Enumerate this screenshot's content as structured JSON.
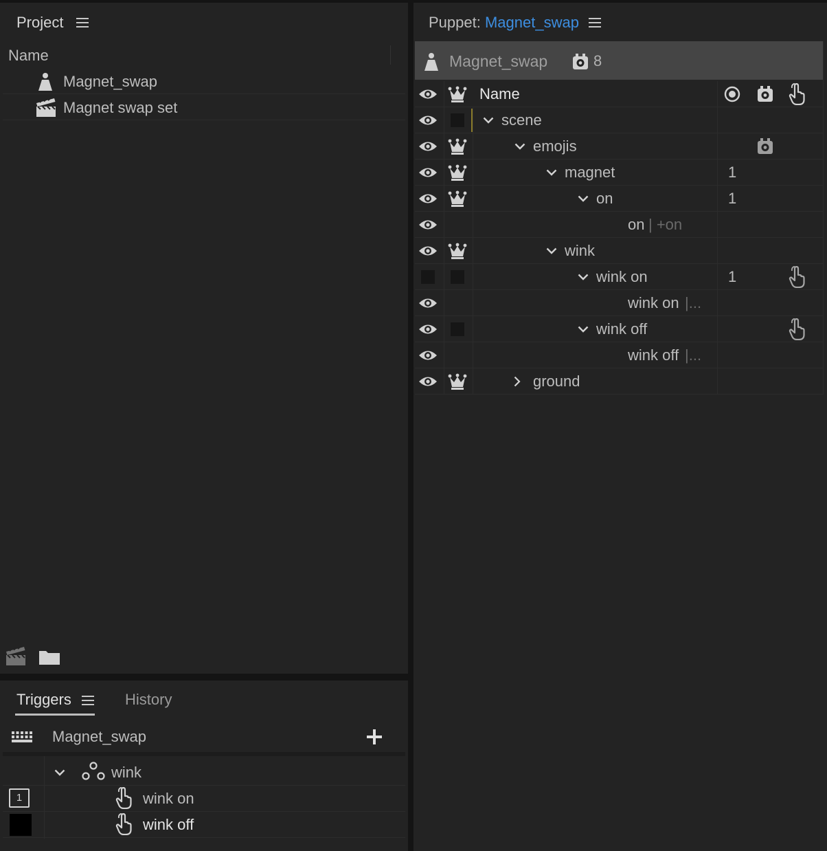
{
  "project": {
    "title": "Project",
    "column_name": "Name",
    "items": [
      {
        "label": "Magnet_swap",
        "icon": "puppet-icon"
      },
      {
        "label": "Magnet swap set",
        "icon": "clapper-icon"
      }
    ]
  },
  "triggers": {
    "tab_triggers": "Triggers",
    "tab_history": "History",
    "puppet_name": "Magnet_swap",
    "group": "wink",
    "items": [
      {
        "label": "wink on",
        "key": "1"
      },
      {
        "label": "wink off",
        "key": ""
      }
    ]
  },
  "puppet": {
    "title_prefix": "Puppet:",
    "title_name": "Magnet_swap",
    "header_name": "Magnet_swap",
    "behavior_count": "8",
    "column_name": "Name",
    "rows": [
      {
        "label": "scene",
        "suffix": "",
        "value": ""
      },
      {
        "label": "emojis",
        "suffix": "",
        "value": ""
      },
      {
        "label": "magnet",
        "suffix": "",
        "value": "1"
      },
      {
        "label": "on",
        "suffix": "",
        "value": "1"
      },
      {
        "label": "on",
        "suffix": "| +on",
        "value": ""
      },
      {
        "label": "wink",
        "suffix": "",
        "value": ""
      },
      {
        "label": "wink on",
        "suffix": "",
        "value": "1"
      },
      {
        "label": "wink on",
        "suffix": "|...",
        "value": ""
      },
      {
        "label": "wink off",
        "suffix": "",
        "value": ""
      },
      {
        "label": "wink off",
        "suffix": "|...",
        "value": ""
      },
      {
        "label": "ground",
        "suffix": "",
        "value": ""
      }
    ]
  },
  "colors": {
    "panel_bg": "#232323",
    "accent_blue": "#3d8ee0",
    "text": "#bdbdbd"
  }
}
